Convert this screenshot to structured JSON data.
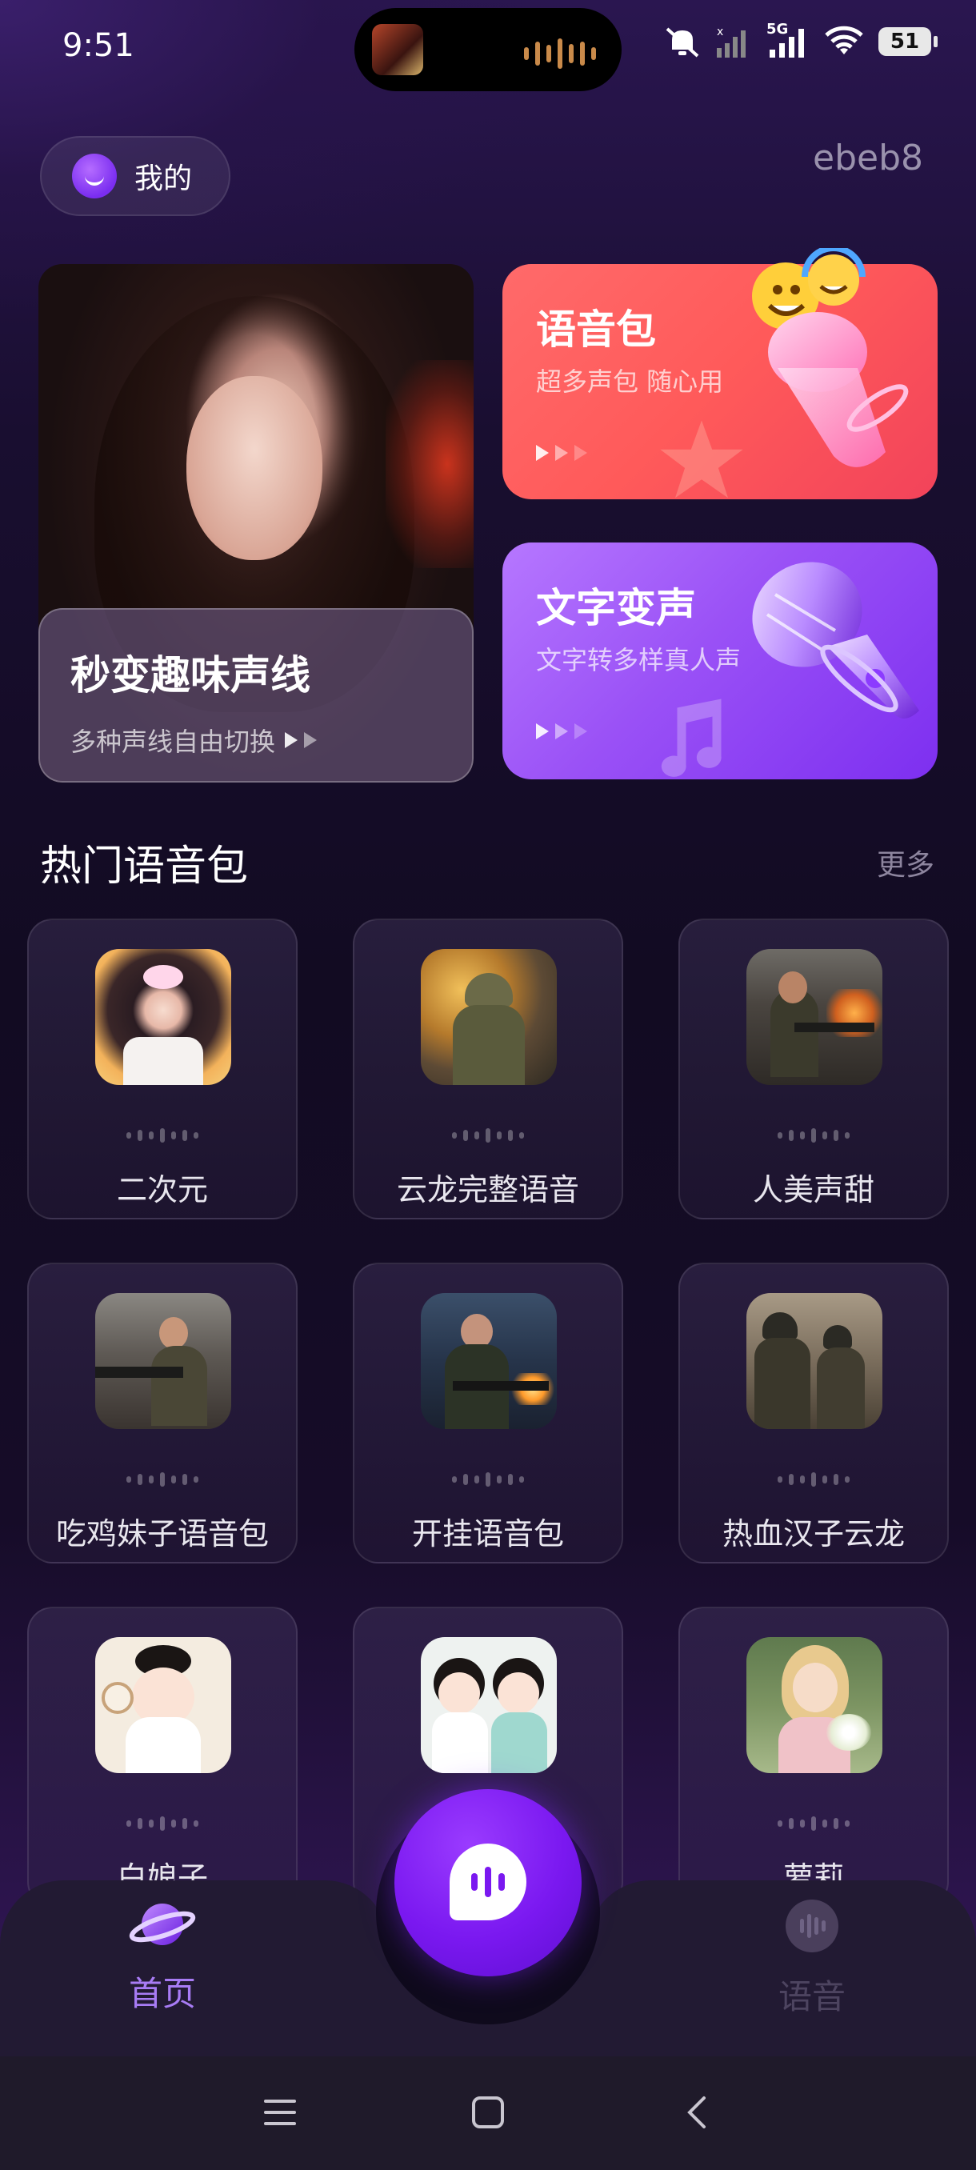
{
  "status_bar": {
    "time": "9:51",
    "network": "5G",
    "battery": "51"
  },
  "header": {
    "mine_label": "我的",
    "user_id": "ebeb8"
  },
  "feature_cards": {
    "voice_change": {
      "title": "秒变趣味声线",
      "subtitle": "多种声线自由切换"
    },
    "voice_pack": {
      "title": "语音包",
      "subtitle": "超多声包 随心用"
    },
    "text_to_voice": {
      "title": "文字变声",
      "subtitle": "文字转多样真人声"
    }
  },
  "hot_section": {
    "title": "热门语音包",
    "more_label": "更多",
    "items": [
      {
        "name": "二次元",
        "thumb": "anime-girl-sakura"
      },
      {
        "name": "云龙完整语音",
        "thumb": "soldier-crouching"
      },
      {
        "name": "人美声甜",
        "thumb": "female-soldier-rifle"
      },
      {
        "name": "吃鸡妹子语音包",
        "thumb": "female-soldier-aiming"
      },
      {
        "name": "开挂语音包",
        "thumb": "female-soldier-firing"
      },
      {
        "name": "热血汉子云龙",
        "thumb": "soldier-squad"
      },
      {
        "name": "白娘子",
        "thumb": "chibi-hanfu-girl"
      },
      {
        "name": "",
        "thumb": "chibi-hanfu-pair"
      },
      {
        "name": "萝莉",
        "thumb": "blonde-girl-flowers"
      }
    ]
  },
  "tabbar": {
    "home_label": "首页",
    "voice_label": "语音"
  },
  "colors": {
    "accent": "#7a18f0",
    "tab_active": "#a87cf5",
    "pack_card": "#ff5a5a",
    "text_card": "#9a51f6"
  }
}
